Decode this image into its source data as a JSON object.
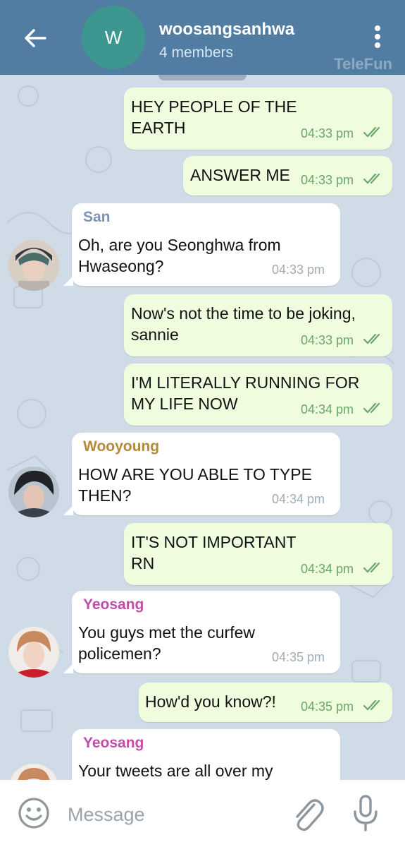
{
  "header": {
    "avatar_letter": "W",
    "avatar_color": "#3e9690",
    "title": "woosangsanhwa",
    "subtitle": "4 members",
    "watermark": "TeleFun",
    "bar_color": "#517da2"
  },
  "messages": [
    {
      "type": "out",
      "lines": [
        "HEY PEOPLE OF THE",
        "EARTH"
      ],
      "time": "04:33 pm"
    },
    {
      "type": "out",
      "lines": [
        "ANSWER ME"
      ],
      "time": "04:33 pm"
    },
    {
      "type": "in",
      "sender": "San",
      "sender_color": "#7d93b5",
      "lines": [
        "Oh, are you Seonghwa from",
        "Hwaseong?"
      ],
      "time": "04:33 pm"
    },
    {
      "type": "out",
      "lines": [
        "Now's not the time to be joking,",
        "sannie"
      ],
      "time": "04:33 pm"
    },
    {
      "type": "out",
      "lines": [
        "I'M LITERALLY RUNNING FOR",
        "MY LIFE NOW"
      ],
      "time": "04:34 pm"
    },
    {
      "type": "in",
      "sender": "Wooyoung",
      "sender_color": "#b48a3a",
      "lines": [
        "HOW ARE YOU ABLE TO TYPE",
        "THEN?"
      ],
      "time": "04:34 pm"
    },
    {
      "type": "out",
      "lines": [
        "IT'S NOT IMPORTANT",
        "RN"
      ],
      "time": "04:34 pm"
    },
    {
      "type": "in",
      "sender": "Yeosang",
      "sender_color": "#c14ea8",
      "lines": [
        "You guys met the curfew",
        "policemen?"
      ],
      "time": "04:35 pm"
    },
    {
      "type": "out",
      "lines": [
        "How'd you know?!"
      ],
      "time": "04:35 pm"
    },
    {
      "type": "in",
      "sender": "Yeosang",
      "sender_color": "#c14ea8",
      "lines": [
        "Your tweets are all over my"
      ],
      "time": ""
    }
  ],
  "input": {
    "placeholder": "Message"
  },
  "colors": {
    "out_bubble": "#effdde",
    "in_bubble": "#ffffff",
    "chat_bg": "#cfdbe6",
    "read_ticks": "#6aa76b"
  },
  "icons": [
    "back-arrow-icon",
    "more-vert-icon",
    "emoji-icon",
    "attach-icon",
    "mic-icon",
    "double-check-icon"
  ]
}
